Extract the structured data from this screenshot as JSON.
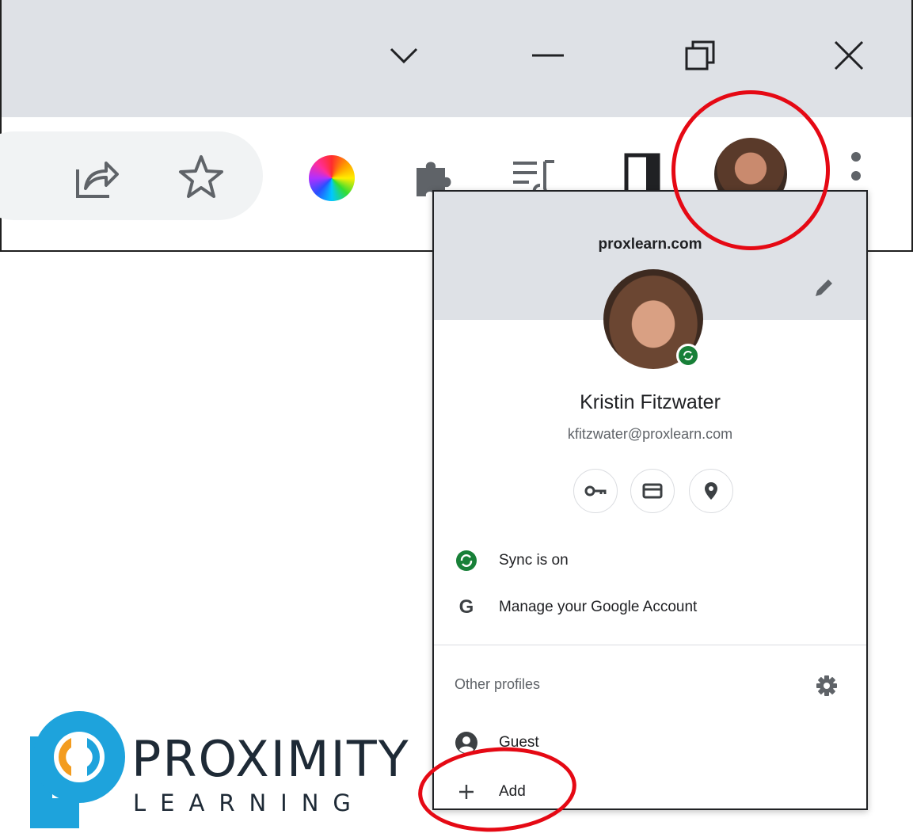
{
  "window_controls": {
    "tabs_menu_icon": "chevron-down-icon",
    "minimize_icon": "minimize-icon",
    "restore_icon": "restore-icon",
    "close_icon": "close-icon"
  },
  "toolbar": {
    "share_icon": "share-icon",
    "bookmark_icon": "star-icon",
    "color_extension_icon": "color-wheel-icon",
    "extensions_icon": "puzzle-icon",
    "media_icon": "media-queue-icon",
    "side_panel_icon": "side-panel-icon",
    "profile_icon": "avatar",
    "more_icon": "more-vert-icon"
  },
  "profile_menu": {
    "domain": "proxlearn.com",
    "name": "Kristin Fitzwater",
    "email": "kfitzwater@proxlearn.com",
    "quick_buttons": [
      "key-icon",
      "card-icon",
      "location-icon"
    ],
    "sync_label": "Sync is on",
    "manage_label": "Manage your Google Account",
    "other_profiles_label": "Other profiles",
    "guest_label": "Guest",
    "add_label": "Add"
  },
  "colors": {
    "chrome_bg": "#dee1e6",
    "sync_green": "#188038",
    "highlight_red": "#e50914",
    "logo_blue": "#1ea3dc",
    "logo_orange": "#f39c1f"
  },
  "logo": {
    "word": "PROXIMITY",
    "sub": "LEARNING"
  }
}
